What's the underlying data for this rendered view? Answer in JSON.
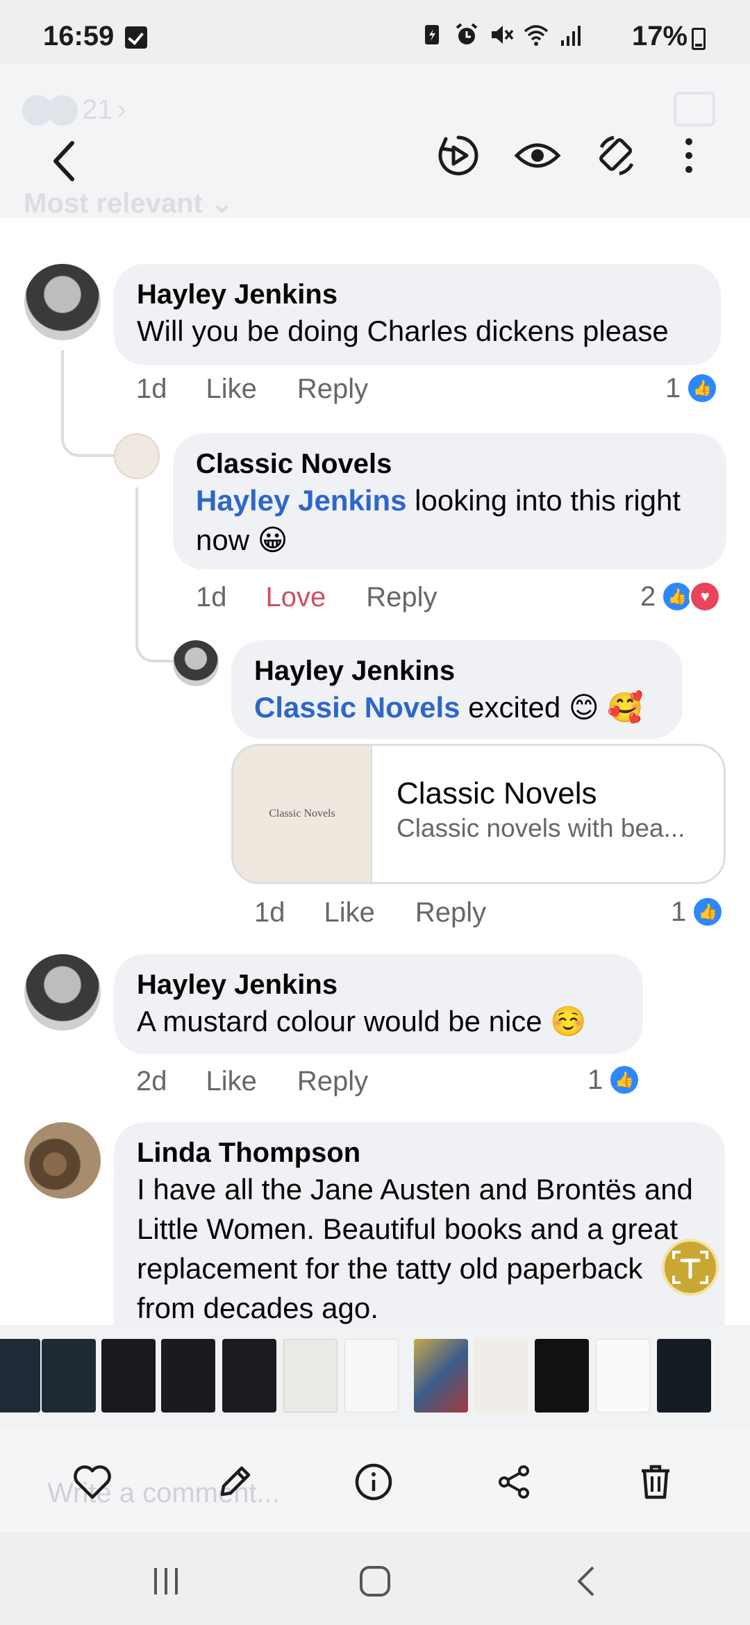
{
  "status": {
    "time": "16:59",
    "battery": "17%"
  },
  "viewer": {
    "ghost_reaction_count": "21",
    "ghost_sort_label": "Most relevant ⌄",
    "ghost_input_placeholder": "Write a comment..."
  },
  "comments": [
    {
      "author": "Hayley Jenkins",
      "text": "Will you be doing Charles dickens please",
      "time": "1d",
      "action1": "Like",
      "action2": "Reply",
      "reaction_count": "1"
    },
    {
      "author": "Classic Novels",
      "mention": "Hayley Jenkins",
      "text_after_mention": " looking into this right",
      "text_line2": "now 😀",
      "time": "1d",
      "action1": "Love",
      "action2": "Reply",
      "reaction_count": "2"
    },
    {
      "author": "Hayley Jenkins",
      "mention": "Classic Novels",
      "text_after_mention": " excited 😊 🥰",
      "time": "1d",
      "action1": "Like",
      "action2": "Reply",
      "reaction_count": "1",
      "link_card": {
        "thumb_text": "Classic Novels",
        "title": "Classic Novels",
        "description": "Classic novels with bea..."
      }
    },
    {
      "author": "Hayley Jenkins",
      "text": "A mustard colour would be nice ☺️",
      "time": "2d",
      "action1": "Like",
      "action2": "Reply",
      "reaction_count": "1"
    },
    {
      "author": "Linda Thompson",
      "text": "I have all the Jane Austen and Brontës and Little Women. Beautiful books and a great replacement for the tatty old paperback from decades ago."
    }
  ],
  "colors": {
    "mention": "#2e66c9",
    "love": "#d0505e",
    "like_reaction": "#2d88ff",
    "love_reaction": "#e8445a",
    "bubble": "#eff1f4"
  },
  "icons": {
    "header": [
      "back-icon",
      "motion-photo-icon",
      "eye-icon",
      "rotate-icon",
      "more-icon"
    ],
    "bottom": [
      "heart-icon",
      "edit-icon",
      "info-icon",
      "share-icon",
      "trash-icon"
    ],
    "nav": [
      "recents-icon",
      "home-icon",
      "back-nav-icon"
    ]
  }
}
